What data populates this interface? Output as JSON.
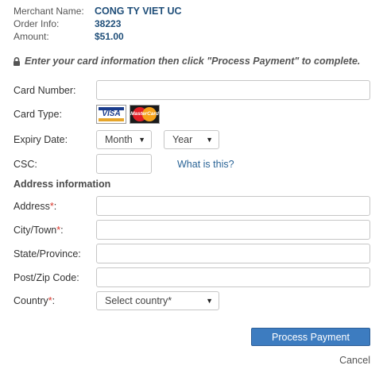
{
  "merchant": {
    "name_label": "Merchant Name:",
    "name_value": "CONG TY VIET UC",
    "order_label": "Order Info:",
    "order_value": "38223",
    "amount_label": "Amount:",
    "amount_value": "$51.00"
  },
  "notice": "Enter your card information then click \"Process Payment\" to complete.",
  "form": {
    "card_number_label": "Card Number:",
    "card_type_label": "Card Type:",
    "visa_text": "VISA",
    "mastercard_text": "MasterCard",
    "expiry_label": "Expiry Date:",
    "month_value": "Month",
    "year_value": "Year",
    "csc_label": "CSC:",
    "csc_help": "What is this?",
    "section_title": "Address information",
    "address_label": "Address",
    "city_label": "City/Town",
    "state_label": "State/Province:",
    "zip_label": "Post/Zip Code:",
    "country_label": "Country",
    "country_value": "Select country*",
    "required_mark": "*",
    "colon": ":"
  },
  "actions": {
    "process_label": "Process Payment",
    "cancel_label": "Cancel"
  },
  "colors": {
    "accent": "#3d7cc0",
    "required": "#d9362b",
    "link": "#2a6496"
  }
}
